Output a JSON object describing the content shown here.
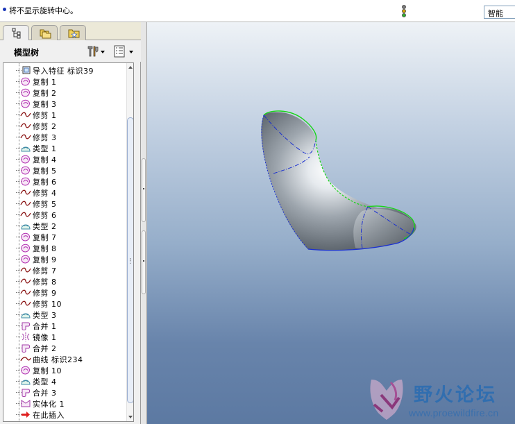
{
  "status": {
    "message": "将不显示旋转中心。",
    "filter_value": "智能"
  },
  "model_tree": {
    "title": "模型树",
    "items": [
      {
        "label": "导入特征  标识39",
        "icon": "import-feature-icon"
      },
      {
        "label": "复制 1",
        "icon": "copy-surface-icon"
      },
      {
        "label": "复制 2",
        "icon": "copy-surface-icon"
      },
      {
        "label": "复制 3",
        "icon": "copy-surface-icon"
      },
      {
        "label": "修剪 1",
        "icon": "trim-icon"
      },
      {
        "label": "修剪 2",
        "icon": "trim-icon"
      },
      {
        "label": "修剪 3",
        "icon": "trim-icon"
      },
      {
        "label": "类型 1",
        "icon": "boundary-blend-icon"
      },
      {
        "label": "复制 4",
        "icon": "copy-surface-icon"
      },
      {
        "label": "复制 5",
        "icon": "copy-surface-icon"
      },
      {
        "label": "复制 6",
        "icon": "copy-surface-icon"
      },
      {
        "label": "修剪 4",
        "icon": "trim-icon"
      },
      {
        "label": "修剪 5",
        "icon": "trim-icon"
      },
      {
        "label": "修剪 6",
        "icon": "trim-icon"
      },
      {
        "label": "类型 2",
        "icon": "boundary-blend-icon"
      },
      {
        "label": "复制 7",
        "icon": "copy-surface-icon"
      },
      {
        "label": "复制 8",
        "icon": "copy-surface-icon"
      },
      {
        "label": "复制 9",
        "icon": "copy-surface-icon"
      },
      {
        "label": "修剪 7",
        "icon": "trim-icon"
      },
      {
        "label": "修剪 8",
        "icon": "trim-icon"
      },
      {
        "label": "修剪 9",
        "icon": "trim-icon"
      },
      {
        "label": "修剪 10",
        "icon": "trim-icon"
      },
      {
        "label": "类型 3",
        "icon": "boundary-blend-icon"
      },
      {
        "label": "合并 1",
        "icon": "merge-icon"
      },
      {
        "label": "镜像 1",
        "icon": "mirror-icon"
      },
      {
        "label": "合并 2",
        "icon": "merge-icon"
      },
      {
        "label": "曲线  标识234",
        "icon": "curve-icon"
      },
      {
        "label": "复制 10",
        "icon": "copy-surface-icon"
      },
      {
        "label": "类型 4",
        "icon": "boundary-blend-icon"
      },
      {
        "label": "合并 3",
        "icon": "merge-icon"
      },
      {
        "label": "实体化 1",
        "icon": "solidify-icon"
      },
      {
        "label": "在此插入",
        "icon": "insert-arrow-icon"
      }
    ]
  },
  "watermark": {
    "title": "野火论坛",
    "url": "www.proewildfire.cn"
  },
  "colors": {
    "viewport_top": "#eef2f6",
    "viewport_bottom": "#5c79a2",
    "edge_green": "#18d418",
    "edge_blue": "#1a2fd0"
  }
}
